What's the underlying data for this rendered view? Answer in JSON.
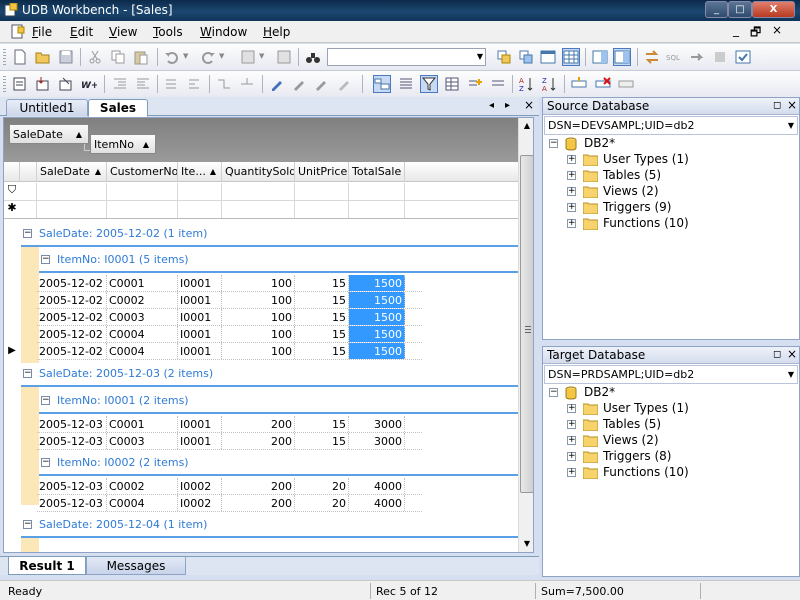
{
  "window": {
    "title": "UDB Workbench - [Sales]",
    "controls": {
      "minimize": "_",
      "maximize": "□",
      "close": "X"
    }
  },
  "menubar": {
    "items": [
      {
        "label": "File",
        "accel": "F",
        "rest": "ile"
      },
      {
        "label": "Edit",
        "accel": "E",
        "rest": "dit"
      },
      {
        "label": "View",
        "accel": "V",
        "rest": "iew"
      },
      {
        "label": "Tools",
        "accel": "T",
        "rest": "ools"
      },
      {
        "label": "Window",
        "accel": "W",
        "rest": "indow"
      },
      {
        "label": "Help",
        "accel": "H",
        "rest": "elp"
      }
    ],
    "mdi": {
      "minimize": "_",
      "restore": "🗗",
      "close": "×"
    }
  },
  "toolbar": {
    "combo_value": ""
  },
  "doc_tabs": [
    {
      "label": "Untitled1",
      "active": false
    },
    {
      "label": "Sales",
      "active": true
    }
  ],
  "tab_nav": {
    "left": "◂",
    "right": "▸",
    "close": "×"
  },
  "grid": {
    "group_by": [
      {
        "label": "SaleDate",
        "sort": "▲"
      },
      {
        "label": "ItemNo",
        "sort": "▲"
      }
    ],
    "columns": [
      {
        "label": "SaleDate",
        "sort": "▲"
      },
      {
        "label": "CustomerNo"
      },
      {
        "label": "Ite...",
        "sort": "▲"
      },
      {
        "label": "QuantitySold"
      },
      {
        "label": "UnitPrice"
      },
      {
        "label": "TotalSale"
      }
    ],
    "filter_symbol": "⛉",
    "new_row_symbol": "✱",
    "groups": [
      {
        "label": "SaleDate: 2005-12-02 (1 item)",
        "subgroups": [
          {
            "label": "ItemNo: I0001 (5 items)",
            "rows": [
              [
                "2005-12-02",
                "C0001",
                "I0001",
                "100",
                "15",
                "1500"
              ],
              [
                "2005-12-02",
                "C0002",
                "I0001",
                "100",
                "15",
                "1500"
              ],
              [
                "2005-12-02",
                "C0003",
                "I0001",
                "100",
                "15",
                "1500"
              ],
              [
                "2005-12-02",
                "C0004",
                "I0001",
                "100",
                "15",
                "1500"
              ],
              [
                "2005-12-02",
                "C0004",
                "I0001",
                "100",
                "15",
                "1500"
              ]
            ]
          }
        ]
      },
      {
        "label": "SaleDate: 2005-12-03 (2 items)",
        "subgroups": [
          {
            "label": "ItemNo: I0001 (2 items)",
            "rows": [
              [
                "2005-12-03",
                "C0001",
                "I0001",
                "200",
                "15",
                "3000"
              ],
              [
                "2005-12-03",
                "C0003",
                "I0001",
                "200",
                "15",
                "3000"
              ]
            ]
          },
          {
            "label": "ItemNo: I0002 (2 items)",
            "rows": [
              [
                "2005-12-03",
                "C0002",
                "I0002",
                "200",
                "20",
                "4000"
              ],
              [
                "2005-12-03",
                "C0004",
                "I0002",
                "200",
                "20",
                "4000"
              ]
            ]
          }
        ]
      },
      {
        "label": "SaleDate: 2005-12-04 (1 item)",
        "subgroups": []
      }
    ],
    "current_row_marker": "▶",
    "highlight_color": "#3399ff"
  },
  "result_tabs": [
    {
      "label": "Result 1",
      "active": true
    },
    {
      "label": "Messages",
      "active": false
    }
  ],
  "source_db": {
    "title": "Source Database",
    "dsn": "DSN=DEVSAMPL;UID=db2",
    "root": "DB2*",
    "nodes": [
      "User Types (1)",
      "Tables (5)",
      "Views (2)",
      "Triggers (9)",
      "Functions (10)"
    ]
  },
  "target_db": {
    "title": "Target Database",
    "dsn": "DSN=PRDSAMPL;UID=db2",
    "root": "DB2*",
    "nodes": [
      "User Types (1)",
      "Tables (5)",
      "Views (2)",
      "Triggers (8)",
      "Functions (10)"
    ]
  },
  "pane_buttons": {
    "float": "◻",
    "close": "×"
  },
  "status": {
    "ready": "Ready",
    "record": "Rec 5 of 12",
    "sum": "Sum=7,500.00"
  },
  "colors": {
    "titlebar": "#1c4770",
    "group_text": "#2f7bd6",
    "group_indent": "#fbe7b7",
    "selection": "#3399ff"
  }
}
